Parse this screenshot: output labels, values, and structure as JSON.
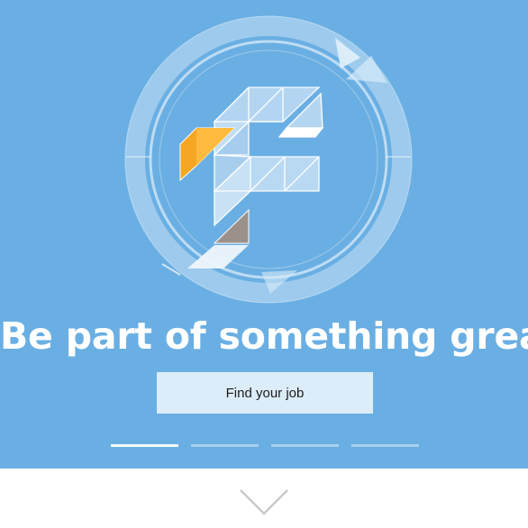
{
  "hero": {
    "headline": "Be part of something great",
    "cta_label": "Find your job",
    "background_color": "#6aafe3",
    "logo_icon": "stylized-f-triangle-logo"
  },
  "carousel": {
    "slide_count": 4,
    "active_index": 0
  },
  "scroll_indicator": {
    "icon": "chevron-down-icon"
  }
}
